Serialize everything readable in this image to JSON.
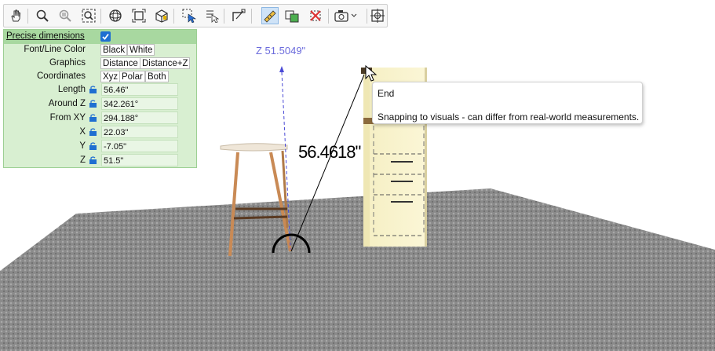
{
  "toolbar": {
    "icons": [
      "hand-pan-icon",
      "zoom-icon",
      "zoom-window-icon",
      "zoom-extents-icon",
      "orbit-icon",
      "fit-view-icon",
      "box-view-icon",
      "select-window-icon",
      "select-list-icon",
      "dimension-icon",
      "measure-icon",
      "snap-icon",
      "cross-delete-icon",
      "camera-icon",
      "center-target-icon"
    ]
  },
  "scene": {
    "z_readout": "Z  51.5049\"",
    "distance_readout": "56.4618\""
  },
  "panel": {
    "title": "Precise dimensions",
    "checked": true,
    "rows": {
      "font_line_color": {
        "label": "Font/Line Color",
        "options": [
          "Black",
          "White"
        ]
      },
      "graphics": {
        "label": "Graphics",
        "options": [
          "Distance",
          "Distance+Z"
        ]
      },
      "coordinates": {
        "label": "Coordinates",
        "options": [
          "Xyz",
          "Polar",
          "Both"
        ]
      },
      "length": {
        "label": "Length",
        "value": "56.46\""
      },
      "around_z": {
        "label": "Around Z",
        "value": "342.261°"
      },
      "from_xy": {
        "label": "From XY",
        "value": "294.188°"
      },
      "x": {
        "label": "X",
        "value": "22.03\""
      },
      "y": {
        "label": "Y",
        "value": "-7.05\""
      },
      "z": {
        "label": "Z",
        "value": "51.5\""
      }
    }
  },
  "tooltip": {
    "title": "End",
    "body": "Snapping to visuals - can differ from real-world measurements."
  },
  "colors": {
    "panel_bg": "#d8efd1",
    "panel_header": "#a8d8a0",
    "accent": "#1f6fd1",
    "z_axis": "#4a4ad6"
  }
}
